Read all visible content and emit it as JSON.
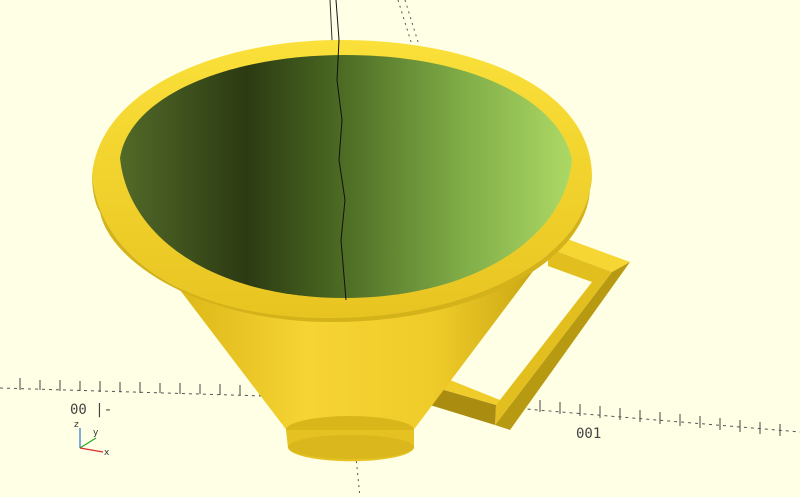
{
  "viewport": {
    "background": "#ffffe5",
    "model_color": "#f7d832",
    "inner_light": "#a6d65e",
    "inner_dark": "#2f3f14"
  },
  "axes_labels": {
    "left_ticks": "00 |-",
    "right_ticks": "001",
    "gizmo_z": "z",
    "gizmo_y": "y",
    "gizmo_x": "x"
  }
}
